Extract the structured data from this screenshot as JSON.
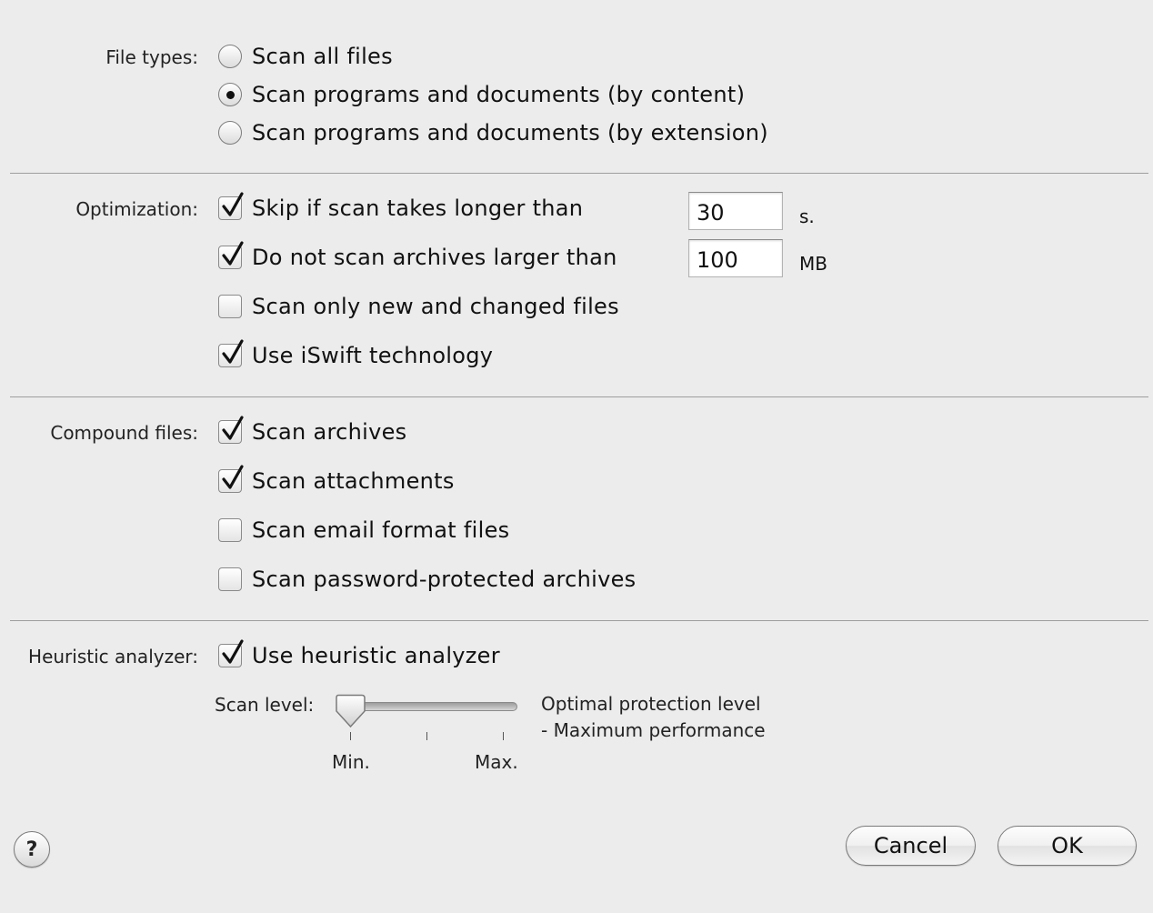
{
  "file_types": {
    "label": "File types:",
    "options": [
      {
        "label": "Scan all files",
        "selected": false
      },
      {
        "label": "Scan programs and documents (by content)",
        "selected": true
      },
      {
        "label": "Scan programs and documents (by extension)",
        "selected": false
      }
    ]
  },
  "optimization": {
    "label": "Optimization:",
    "skip_long_scan": {
      "label": "Skip if scan takes longer than",
      "checked": true,
      "value": "30",
      "unit": "s."
    },
    "skip_large_archives": {
      "label": "Do not scan archives larger than",
      "checked": true,
      "value": "100",
      "unit": "MB"
    },
    "only_new_changed": {
      "label": "Scan only new and changed files",
      "checked": false
    },
    "iswift": {
      "label": "Use iSwift technology",
      "checked": true
    }
  },
  "compound_files": {
    "label": "Compound files:",
    "items": [
      {
        "label": "Scan archives",
        "checked": true
      },
      {
        "label": "Scan attachments",
        "checked": true
      },
      {
        "label": "Scan email format files",
        "checked": false
      },
      {
        "label": "Scan password-protected archives",
        "checked": false
      }
    ]
  },
  "heuristic": {
    "label": "Heuristic analyzer:",
    "use": {
      "label": "Use heuristic analyzer",
      "checked": true
    },
    "scan_level_label": "Scan level:",
    "slider": {
      "level": 0,
      "min_label": "Min.",
      "max_label": "Max."
    },
    "description_line1": "Optimal protection level",
    "description_line2": "- Maximum performance"
  },
  "buttons": {
    "help": "?",
    "cancel": "Cancel",
    "ok": "OK"
  }
}
